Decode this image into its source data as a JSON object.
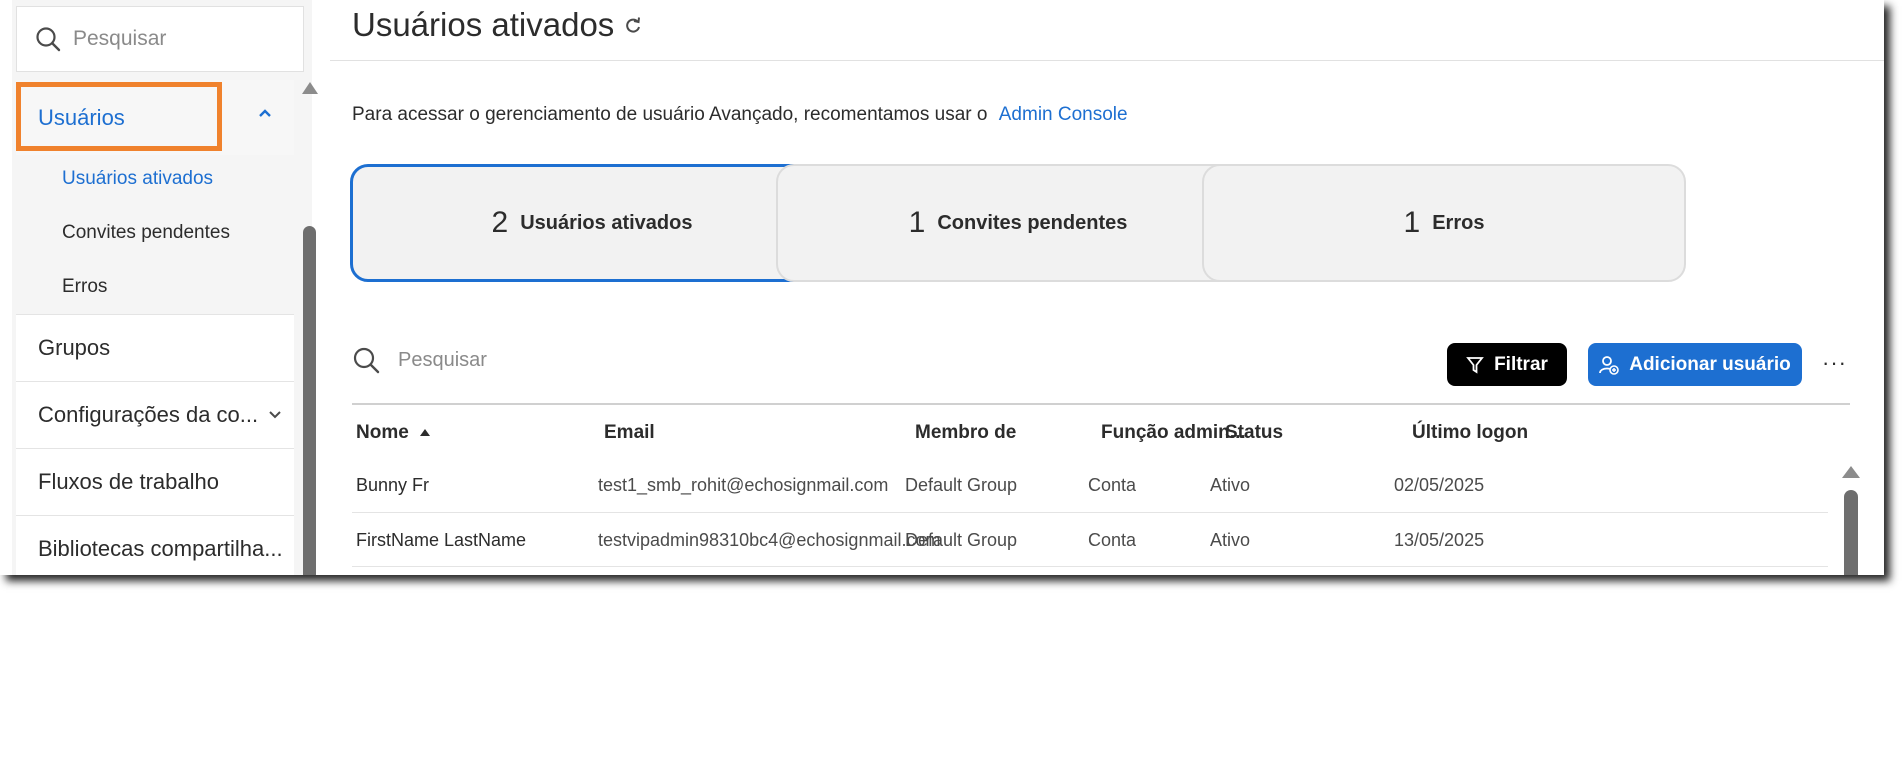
{
  "sidebar": {
    "search_placeholder": "Pesquisar",
    "users_label": "Usuários",
    "sub_items": [
      "Usuários ativados",
      "Convites pendentes",
      "Erros"
    ],
    "items": [
      "Grupos",
      "Configurações da co...",
      "Fluxos de trabalho",
      "Bibliotecas compartilha..."
    ]
  },
  "main": {
    "title": "Usuários ativados",
    "notice_text": "Para acessar o gerenciamento de usuário Avançado, recomentamos usar o",
    "notice_link": "Admin Console",
    "cards": [
      {
        "count": "2",
        "label": "Usuários ativados"
      },
      {
        "count": "1",
        "label": "Convites pendentes"
      },
      {
        "count": "1",
        "label": "Erros"
      }
    ],
    "search_placeholder": "Pesquisar",
    "filter_label": "Filtrar",
    "add_user_label": "Adicionar usuário",
    "more_label": "···",
    "columns": [
      "Nome",
      "Email",
      "Membro de",
      "Função admin...",
      "Status",
      "Último logon"
    ],
    "rows": [
      [
        "Bunny Fr",
        "test1_smb_rohit@echosignmail.com",
        "Default Group",
        "Conta",
        "Ativo",
        "02/05/2025"
      ],
      [
        "FirstName LastName",
        "testvipadmin98310bc4@echosignmail.com",
        "Default Group",
        "Conta",
        "Ativo",
        "13/05/2025"
      ]
    ]
  },
  "colors": {
    "accent": "#1d6fd1",
    "highlight": "#f0822d"
  }
}
